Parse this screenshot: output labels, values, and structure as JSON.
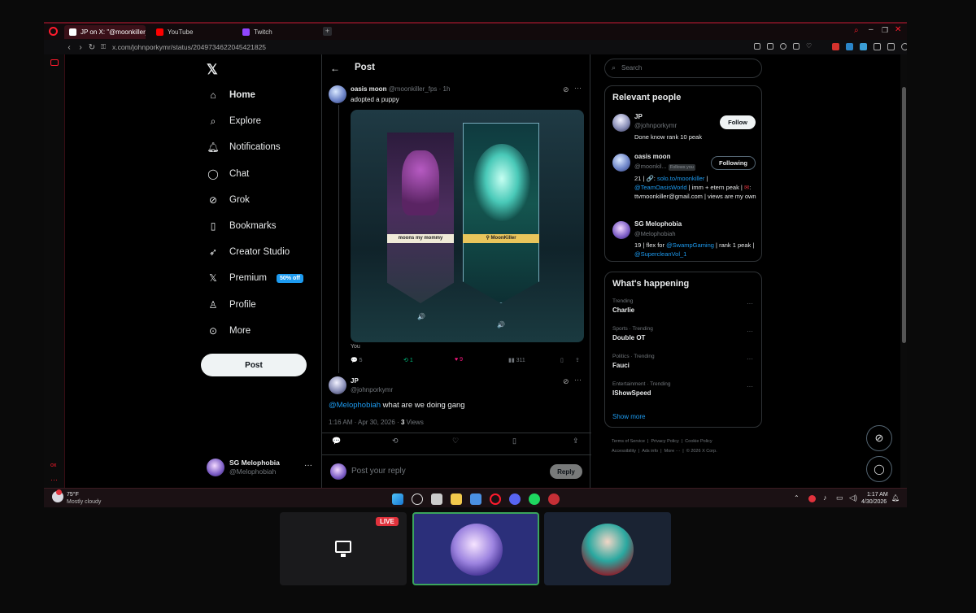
{
  "browser": {
    "tabs": [
      {
        "label": "JP on X: \"@moonkiller_fps",
        "active": true
      },
      {
        "label": "YouTube",
        "active": false
      },
      {
        "label": "Twitch",
        "active": false
      }
    ],
    "url": "x.com/johnporkymr/status/2049734622045421825"
  },
  "sidebar": {
    "items": [
      {
        "label": "Home",
        "icon": "home-icon"
      },
      {
        "label": "Explore",
        "icon": "search-icon"
      },
      {
        "label": "Notifications",
        "icon": "bell-icon"
      },
      {
        "label": "Chat",
        "icon": "chat-icon"
      },
      {
        "label": "Grok",
        "icon": "grok-icon"
      },
      {
        "label": "Bookmarks",
        "icon": "bookmark-icon"
      },
      {
        "label": "Creator Studio",
        "icon": "rocket-icon"
      },
      {
        "label": "Premium",
        "icon": "x-logo-icon"
      },
      {
        "label": "Profile",
        "icon": "person-icon"
      },
      {
        "label": "More",
        "icon": "more-circle-icon"
      }
    ],
    "premium_badge": "50% off",
    "post_label": "Post",
    "account": {
      "name": "SG Melophobia",
      "handle": "@Melophobiah"
    }
  },
  "post": {
    "header": "Post",
    "quoted": {
      "name": "oasis moon",
      "handle": "@moonkiller_fps",
      "time": "· 1h",
      "text": "adopted a puppy",
      "card_left_label": "moons my mommy",
      "card_right_label": "MoonKiller",
      "caption": "You",
      "stats": {
        "replies": "5",
        "reposts": "1",
        "likes": "9",
        "views": "311"
      }
    },
    "main": {
      "name": "JP",
      "handle": "@johnporkymr",
      "mention": "@Melophobiah",
      "text": " what are we doing gang",
      "meta": "1:16 AM · Apr 30, 2026 · ",
      "views_count": "3",
      "views_label": " Views"
    },
    "reply_placeholder": "Post your reply",
    "reply_btn": "Reply"
  },
  "right": {
    "search_placeholder": "Search",
    "relevant_title": "Relevant people",
    "people": [
      {
        "name": "JP",
        "handle": "@johnporkymr",
        "bio": "Done know rank 10 peak",
        "button": "Follow"
      },
      {
        "name": "oasis moon",
        "handle": "@moonkil...",
        "follows_you": "Follows you",
        "bio_link1": "solo.to/moonkiller",
        "bio_link2": "@TeamOasisWorld",
        "bio_a": "21 | 🔗: ",
        "bio_b": " |",
        "bio_c": " | imm + etern peak |",
        "bio_d": ": ttvmoonkiller@gmail.com | views are my own",
        "button": "Following"
      },
      {
        "name": "SG Melophobia",
        "handle": "@Melophobiah",
        "bio_a": "19 | flex for ",
        "bio_link1": "@SwampGaming",
        "bio_b": " | rank 1 peak | ",
        "bio_link2": "@SupercleanVol_1"
      }
    ],
    "happening_title": "What's happening",
    "trends": [
      {
        "context": "Trending",
        "name": "Charlie"
      },
      {
        "context": "Sports · Trending",
        "name": "Double OT"
      },
      {
        "context": "Politics · Trending",
        "name": "Fauci"
      },
      {
        "context": "Entertainment · Trending",
        "name": "IShowSpeed"
      }
    ],
    "show_more": "Show more",
    "footer": [
      "Terms of Service",
      "Privacy Policy",
      "Cookie Policy",
      "Accessibility",
      "Ads info",
      "More ···",
      "© 2026 X Corp."
    ]
  },
  "taskbar": {
    "weather_temp": "75°F",
    "weather_desc": "Mostly cloudy",
    "time": "1:17 AM",
    "date": "4/30/2026"
  },
  "stream": {
    "live_label": "LIVE"
  },
  "colors": {
    "accent": "#1d9bf0",
    "opera_red": "#ff1b2d",
    "like_pink": "#f91880",
    "repost_green": "#00ba7c",
    "live_red": "#e0323c"
  }
}
